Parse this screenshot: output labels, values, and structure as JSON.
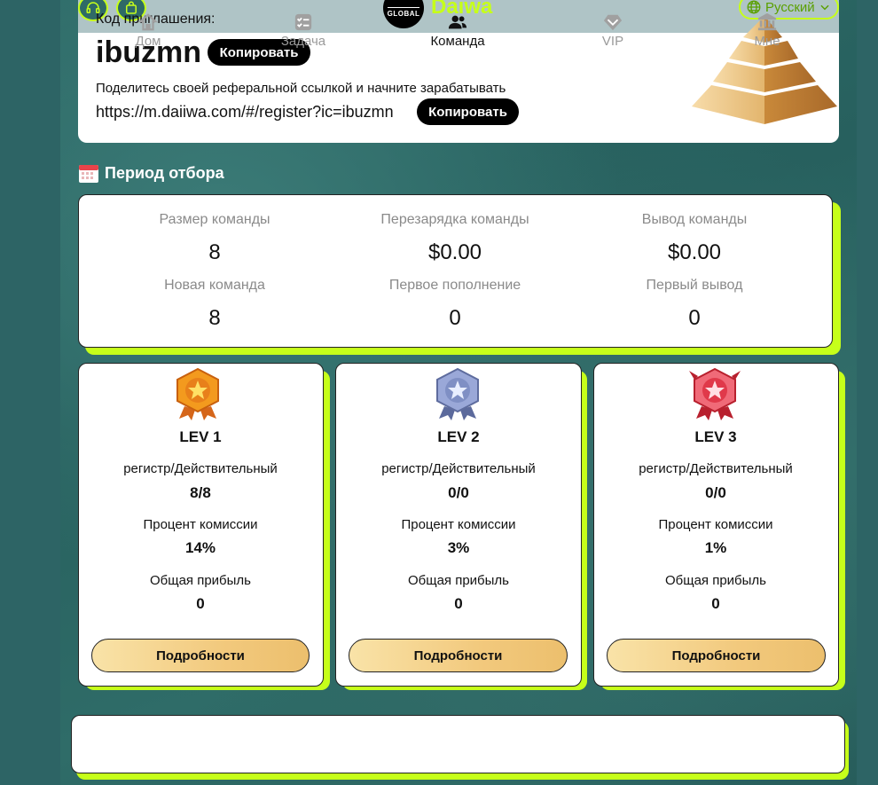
{
  "header": {
    "brand": "Daiwa",
    "logo_text": "GLOBAL",
    "language": "Русский"
  },
  "invite": {
    "label": "Код приглашения:",
    "code": "ibuzmn",
    "copy_code_label": "Копировать",
    "share_text": "Поделитесь своей реферальной ссылкой и начните зарабатывать",
    "link": "https://m.daiiwa.com/#/register?ic=ibuzmn",
    "copy_link_label": "Копировать"
  },
  "period": {
    "title": "Период отбора",
    "stats": [
      {
        "label": "Размер команды",
        "value": "8"
      },
      {
        "label": "Перезарядка команды",
        "value": "$0.00"
      },
      {
        "label": "Вывод команды",
        "value": "$0.00"
      },
      {
        "label": "Новая команда",
        "value": "8"
      },
      {
        "label": "Первое пополнение",
        "value": "0"
      },
      {
        "label": "Первый вывод",
        "value": "0"
      }
    ]
  },
  "levels": [
    {
      "title": "LEV 1",
      "reg_label": "регистр/Действительный",
      "reg_value": "8/8",
      "commission_label": "Процент комиссии",
      "commission_value": "14%",
      "profit_label": "Общая прибыль",
      "profit_value": "0",
      "details_label": "Подробности",
      "badge_color": "#f39a1e"
    },
    {
      "title": "LEV 2",
      "reg_label": "регистр/Действительный",
      "reg_value": "0/0",
      "commission_label": "Процент комиссии",
      "commission_value": "3%",
      "profit_label": "Общая прибыль",
      "profit_value": "0",
      "details_label": "Подробности",
      "badge_color": "#7f8fc4"
    },
    {
      "title": "LEV 3",
      "reg_label": "регистр/Действительный",
      "reg_value": "0/0",
      "commission_label": "Процент комиссии",
      "commission_value": "1%",
      "profit_label": "Общая прибыль",
      "profit_value": "0",
      "details_label": "Подробности",
      "badge_color": "#e0394a"
    }
  ],
  "nav": [
    {
      "label": "Дом",
      "icon": "home-icon"
    },
    {
      "label": "Задача",
      "icon": "task-icon"
    },
    {
      "label": "Команда",
      "icon": "team-icon",
      "active": true
    },
    {
      "label": "VIP",
      "icon": "vip-icon"
    },
    {
      "label": "Мне",
      "icon": "bank-icon"
    }
  ],
  "colors": {
    "accent": "#c6ff1a",
    "background": "#2b5f60",
    "button_dark": "#000000",
    "details_gradient_start": "#f9e3a8",
    "details_gradient_end": "#ecbf6d"
  }
}
